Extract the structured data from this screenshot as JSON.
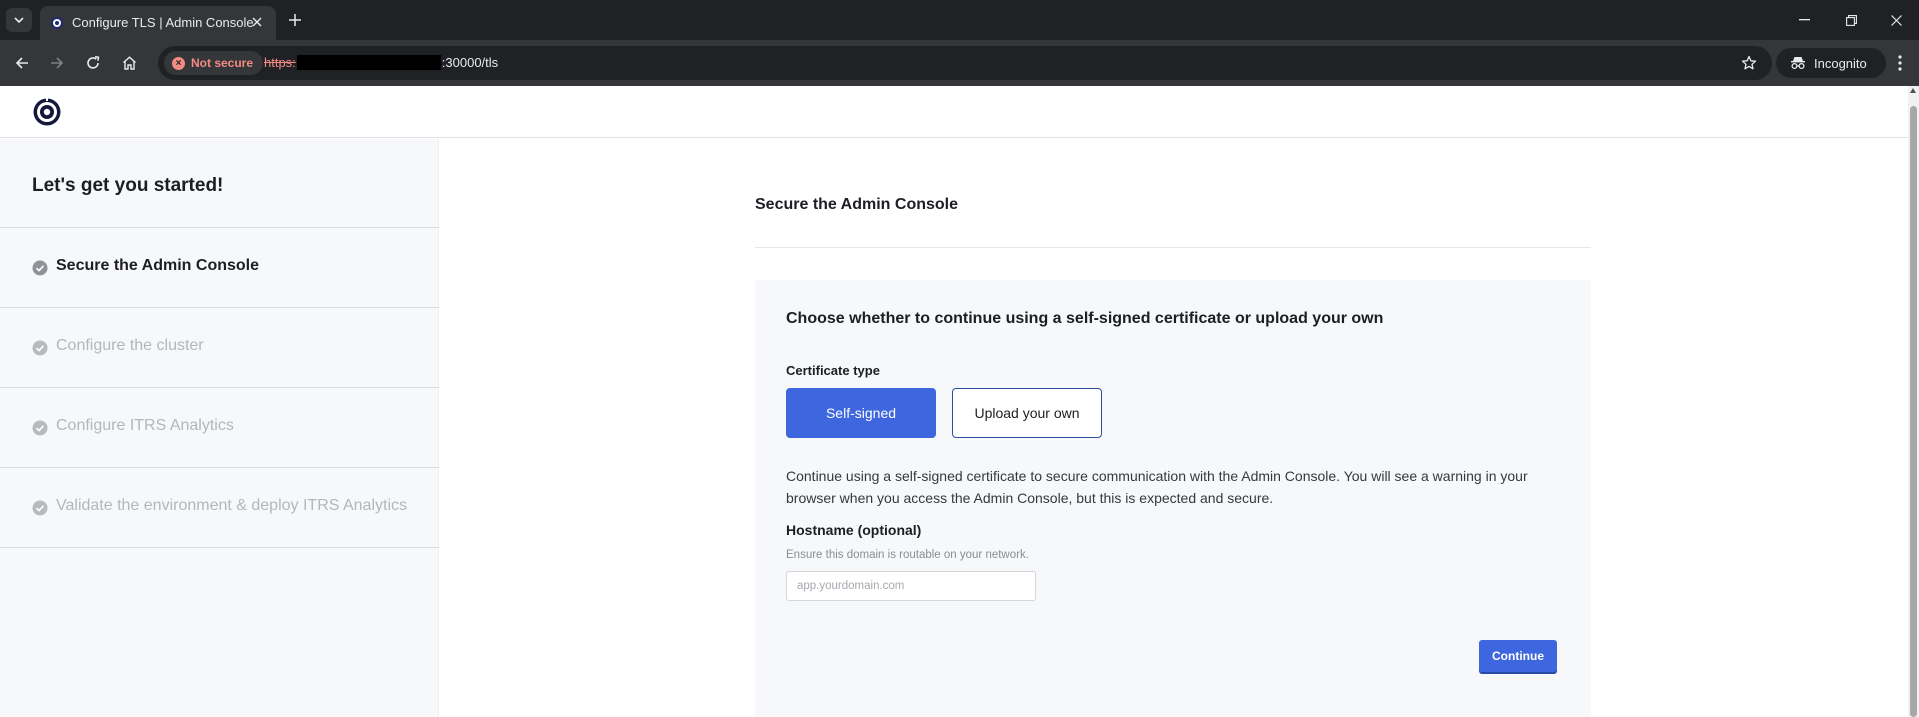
{
  "browser": {
    "tab_title": "Configure TLS | Admin Console",
    "security_chip": "Not secure",
    "url_scheme": "https:",
    "url_rest": ":30000/tls",
    "incognito_label": "Incognito"
  },
  "sidebar": {
    "heading": "Let's get you started!",
    "steps": [
      {
        "label": "Secure the Admin Console",
        "active": true
      },
      {
        "label": "Configure the cluster",
        "active": false
      },
      {
        "label": "Configure ITRS Analytics",
        "active": false
      },
      {
        "label": "Validate the environment & deploy ITRS Analytics",
        "active": false
      }
    ]
  },
  "main": {
    "title": "Secure the Admin Console",
    "card": {
      "title": "Choose whether to continue using a self-signed certificate or upload your own",
      "certificate_type_label": "Certificate type",
      "options": {
        "self_signed": "Self-signed",
        "upload_own": "Upload your own"
      },
      "selected_option": "Self-signed",
      "description": "Continue using a self-signed certificate to secure communication with the Admin Console. You will see a warning in your browser when you access the Admin Console, but this is expected and secure.",
      "hostname": {
        "label": "Hostname (optional)",
        "help": "Ensure this domain is routable on your network.",
        "placeholder": "app.yourdomain.com",
        "value": ""
      },
      "continue_label": "Continue"
    }
  },
  "colors": {
    "accent": "#3e66df",
    "sidebar_bg": "#f7f8fa",
    "browser_dark": "#202124",
    "not_secure_red": "#f28b82"
  }
}
